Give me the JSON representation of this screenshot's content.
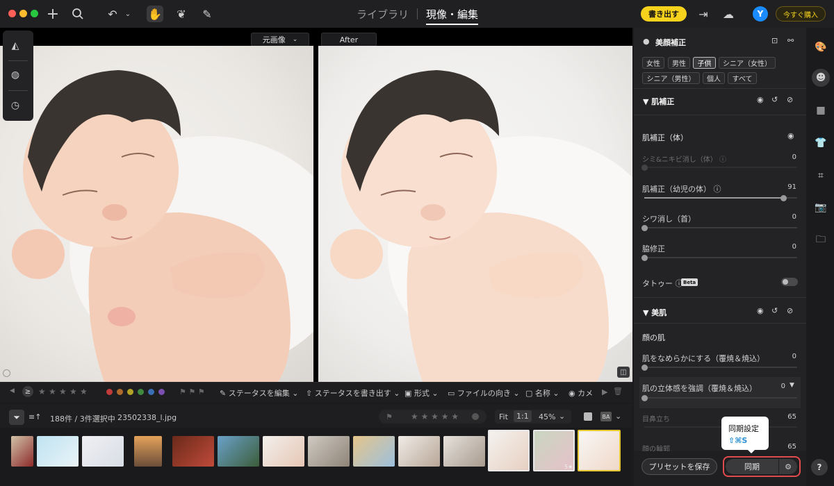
{
  "topbar": {
    "tabs": [
      {
        "label": "ライブラリ",
        "active": false
      },
      {
        "label": "現像・編集",
        "active": true
      }
    ],
    "export_label": "書き出す",
    "avatar_initial": "Y",
    "buy_label": "今すぐ購入",
    "accent_color": "#f7d21c"
  },
  "viewer": {
    "before_label": "元画像",
    "after_label": "After"
  },
  "filterbar": {
    "edit_status": "ステータスを編集",
    "export_status": "ステータスを書き出す",
    "format": "形式",
    "orientation": "ファイルの向き",
    "name": "名称",
    "camera": "カメ",
    "label_colors": [
      "#c23b3b",
      "#b06a2a",
      "#b3a226",
      "#3f8a3f",
      "#3a6fb5",
      "#7a4fb0"
    ]
  },
  "infobar": {
    "count": "188件 / 3件選択中",
    "filename": "23502338_l.jpg",
    "zoom_fit": "Fit",
    "zoom_1to1": "1:1",
    "zoom_percent": "45%"
  },
  "filmstrip": {
    "rating_badge": "5★"
  },
  "panel": {
    "title": "美顔補正",
    "chips_row1": [
      {
        "label": "女性",
        "active": false
      },
      {
        "label": "男性",
        "active": false
      },
      {
        "label": "子供",
        "active": true
      },
      {
        "label": "シニア（女性）",
        "active": false
      }
    ],
    "chips_row2": [
      {
        "label": "シニア（男性）",
        "active": false
      },
      {
        "label": "個人",
        "active": false
      },
      {
        "label": "すべて",
        "active": false
      }
    ],
    "section_skin": "肌補正",
    "subsection_body": "肌補正（体）",
    "sliders": [
      {
        "label": "シミ&ニキビ消し（体）",
        "value": "0",
        "level": 0,
        "disabled": true
      },
      {
        "label": "肌補正（幼児の体）",
        "value": "91",
        "level": 0.91,
        "disabled": false
      },
      {
        "label": "シワ消し（首）",
        "value": "0",
        "level": 0,
        "disabled": false
      },
      {
        "label": "脇修正",
        "value": "0",
        "level": 0,
        "disabled": false
      }
    ],
    "tattoo_label": "タトゥー",
    "beta_label": "Beta",
    "section_beauty": "美肌",
    "subsection_face": "顔の肌",
    "beauty_sliders": [
      {
        "label": "肌をなめらかにする（覆焼＆焼込）",
        "value": "0",
        "level": 0
      },
      {
        "label": "肌の立体感を強調（覆焼＆焼込）",
        "value": "0",
        "level": 0
      }
    ],
    "dim_rows": [
      {
        "label": "目鼻立ち",
        "value": "65"
      },
      {
        "label": "顔の輪郭",
        "value": "65"
      }
    ]
  },
  "footer": {
    "save_preset": "プリセットを保存",
    "sync": "同期",
    "tooltip_title": "同期設定",
    "tooltip_shortcut": "⇧⌘S"
  }
}
